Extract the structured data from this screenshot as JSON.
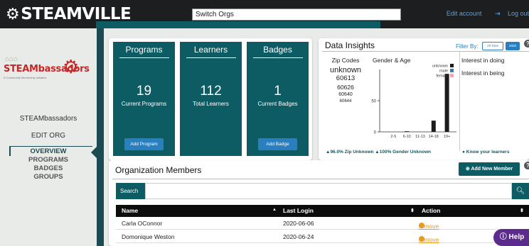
{
  "topbar": {
    "logo_word": "STEAMVILLE",
    "switch_orgs_value": "Switch Orgs",
    "edit_account": "Edit account",
    "logout": "Log out"
  },
  "sidebar": {
    "org_logo_text": "STEAMbassadors",
    "org_logo_tagline": "A Community Mentorship Initiative",
    "org_name": "STEAMbassadors",
    "edit_org": "EDIT ORG",
    "nav": [
      "OVERVIEW",
      "PROGRAMS",
      "BADGES",
      "GROUPS"
    ],
    "active": "OVERVIEW"
  },
  "stats": [
    {
      "title": "Programs",
      "value": "19",
      "sub": "Current Programs",
      "button": "Add Program"
    },
    {
      "title": "Learners",
      "value": "112",
      "sub": "Total Learners",
      "button": null
    },
    {
      "title": "Badges",
      "value": "1",
      "sub": "Current Badges",
      "button": "Add Badge"
    }
  ],
  "insights": {
    "title": "Data Insights",
    "filter_label": "Filter By:",
    "filter_all": "All Time",
    "filter_2020": "2020",
    "zip_header": "Zip Codes",
    "zip_codes": [
      "unknown",
      "60613",
      "60626",
      "60640",
      "60644"
    ],
    "gender_header": "Gender & Age",
    "interest_doing": "Interest in doing",
    "interest_being": "Interest in being",
    "footer_zip": "96.0% Zip Unknown",
    "footer_gender": "100% Gender Unknown",
    "footer_know": "Know your learners"
  },
  "chart_data": {
    "type": "bar",
    "categories": [
      "2-5",
      "6-10",
      "11-13",
      "14-18",
      "19+"
    ],
    "series": [
      {
        "name": "unknown",
        "values": [
          0,
          1,
          0,
          18,
          93
        ],
        "color": "#1c1c1c"
      },
      {
        "name": "male",
        "values": [
          0,
          0,
          0,
          0,
          0
        ],
        "color": "#2a7fc0"
      },
      {
        "name": "female",
        "values": [
          0,
          0,
          0,
          0,
          0
        ],
        "color": "#f4a3b5"
      }
    ],
    "yticks": [
      0,
      50
    ],
    "ylim": [
      0,
      100
    ],
    "legend": "top-right"
  },
  "members": {
    "title": "Organization Members",
    "add_button": "Add New Member",
    "search_label": "Search",
    "columns": [
      "Name",
      "Last Login",
      "Action"
    ],
    "rows": [
      {
        "name": "Carla OConnor",
        "last_login": "2020-06-06",
        "action": "remove"
      },
      {
        "name": "Domonique Weston",
        "last_login": "2020-06-24",
        "action": "remove"
      }
    ]
  },
  "help_button": "Help"
}
